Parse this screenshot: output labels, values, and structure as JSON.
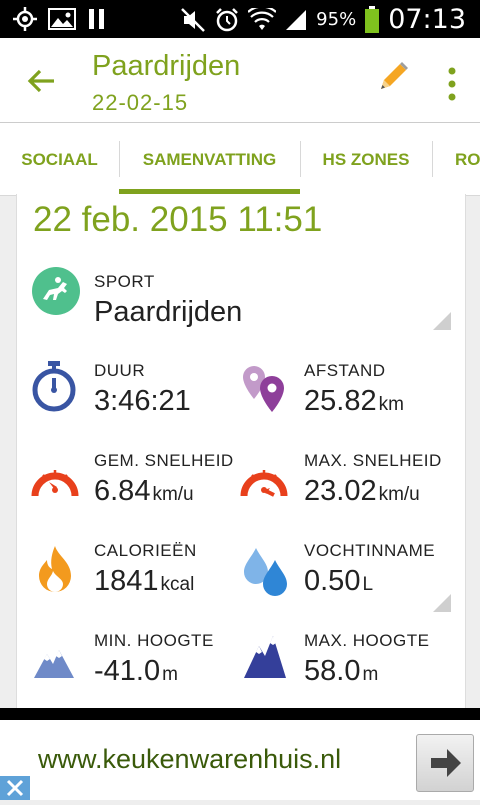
{
  "status_bar": {
    "battery_percent": "95%",
    "time": "07:13",
    "left_icons": [
      "gps-icon",
      "image-icon",
      "pause-icon"
    ],
    "right_icons": [
      "mute-icon",
      "alarm-icon",
      "wifi-icon",
      "signal-icon",
      "battery-icon"
    ]
  },
  "app_bar": {
    "title": "Paardrijden",
    "subtitle": "22-02-15",
    "icons": [
      "back-arrow-icon",
      "edit-pencil-icon",
      "more-vert-icon"
    ]
  },
  "tabs": [
    {
      "label": "SOCIAAL"
    },
    {
      "label": "SAMENVATTING",
      "selected": true
    },
    {
      "label": "HS ZONES"
    },
    {
      "label": "RO"
    }
  ],
  "summary": {
    "date_time": "22 feb. 2015 11:51",
    "sport": {
      "label": "SPORT",
      "value": "Paardrijden",
      "icon": "horse-riding-icon"
    },
    "stats": [
      {
        "label": "DUUR",
        "value": "3:46:21",
        "unit": "",
        "icon": "stopwatch-icon"
      },
      {
        "label": "AFSTAND",
        "value": "25.82",
        "unit": "km",
        "icon": "distance-pins-icon"
      },
      {
        "label": "GEM. SNELHEID",
        "value": "6.84",
        "unit": "km/u",
        "icon": "speedometer-icon"
      },
      {
        "label": "MAX. SNELHEID",
        "value": "23.02",
        "unit": "km/u",
        "icon": "speedometer-icon"
      },
      {
        "label": "CALORIEËN",
        "value": "1841",
        "unit": "kcal",
        "icon": "flame-icon"
      },
      {
        "label": "VOCHTINNAME",
        "value": "0.50",
        "unit": "L",
        "icon": "water-drops-icon"
      },
      {
        "label": "MIN. HOOGTE",
        "value": "-41.0",
        "unit": "m",
        "icon": "mountain-icon"
      },
      {
        "label": "MAX. HOOGTE",
        "value": "58.0",
        "unit": "m",
        "icon": "mountain-icon"
      }
    ]
  },
  "ad": {
    "text": "www.keukenwarenhuis.nl",
    "icons": [
      "arrow-right-icon",
      "close-icon"
    ]
  },
  "colors": {
    "accent": "#7fa21e",
    "stopwatch": "#3955a3",
    "pins": "#8e3f9a",
    "speed": "#e8401c",
    "flame": "#f39a1e",
    "drops": "#2f86d6",
    "mountain_light": "#6f8ac8",
    "mountain_dark": "#343f9a",
    "sport_bg": "#4fc08d"
  }
}
